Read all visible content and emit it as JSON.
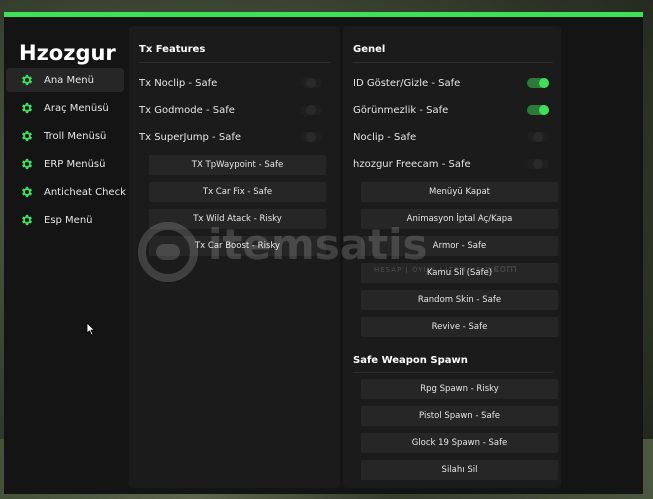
{
  "app": {
    "title": "Hzozgur",
    "accent": "#3ee05a"
  },
  "sidebar": {
    "items": [
      {
        "label": "Ana Menü",
        "icon": "gear-icon",
        "active": true
      },
      {
        "label": "Araç Menüsü",
        "icon": "gear-icon",
        "active": false
      },
      {
        "label": "Troll Menüsü",
        "icon": "gear-icon",
        "active": false
      },
      {
        "label": "ERP Menüsü",
        "icon": "gear-icon",
        "active": false
      },
      {
        "label": "Anticheat Check",
        "icon": "gear-icon",
        "active": false
      },
      {
        "label": "Esp Menü",
        "icon": "gear-icon",
        "active": false
      }
    ]
  },
  "left_panel": {
    "title": "Tx Features",
    "toggles": [
      {
        "label": "Tx Noclip - Safe",
        "on": false
      },
      {
        "label": "Tx Godmode - Safe",
        "on": false
      },
      {
        "label": "Tx SuperJump - Safe",
        "on": false
      }
    ],
    "buttons": [
      "TX TpWaypoint - Safe",
      "Tx Car Fix - Safe",
      "Tx Wild Atack - Risky",
      "Tx Car Boost - Risky"
    ]
  },
  "right_panel": {
    "title": "Genel",
    "toggles": [
      {
        "label": "ID Göster/Gizle - Safe",
        "on": true
      },
      {
        "label": "Görünmezlik - Safe",
        "on": true
      },
      {
        "label": "Noclip - Safe",
        "on": false
      },
      {
        "label": "hzozgur Freecam - Safe",
        "on": false
      }
    ],
    "buttons": [
      "Menüyü Kapat",
      "Animasyon İptal Aç/Kapa",
      "Armor - Safe",
      "Kamu Sil (Safe)",
      "Random Skin - Safe",
      "Revive - Safe"
    ],
    "weapon_title": "Safe Weapon Spawn",
    "weapon_buttons": [
      "Rpg Spawn - Risky",
      "Pistol Spawn - Safe",
      "Glock 19 Spawn - Safe",
      "Silahı Sil"
    ]
  },
  "watermark": {
    "text": "itemsatis",
    "subtitle": "HESAP | OYUN | ITEM | E-PIN",
    "domain": ".com"
  }
}
